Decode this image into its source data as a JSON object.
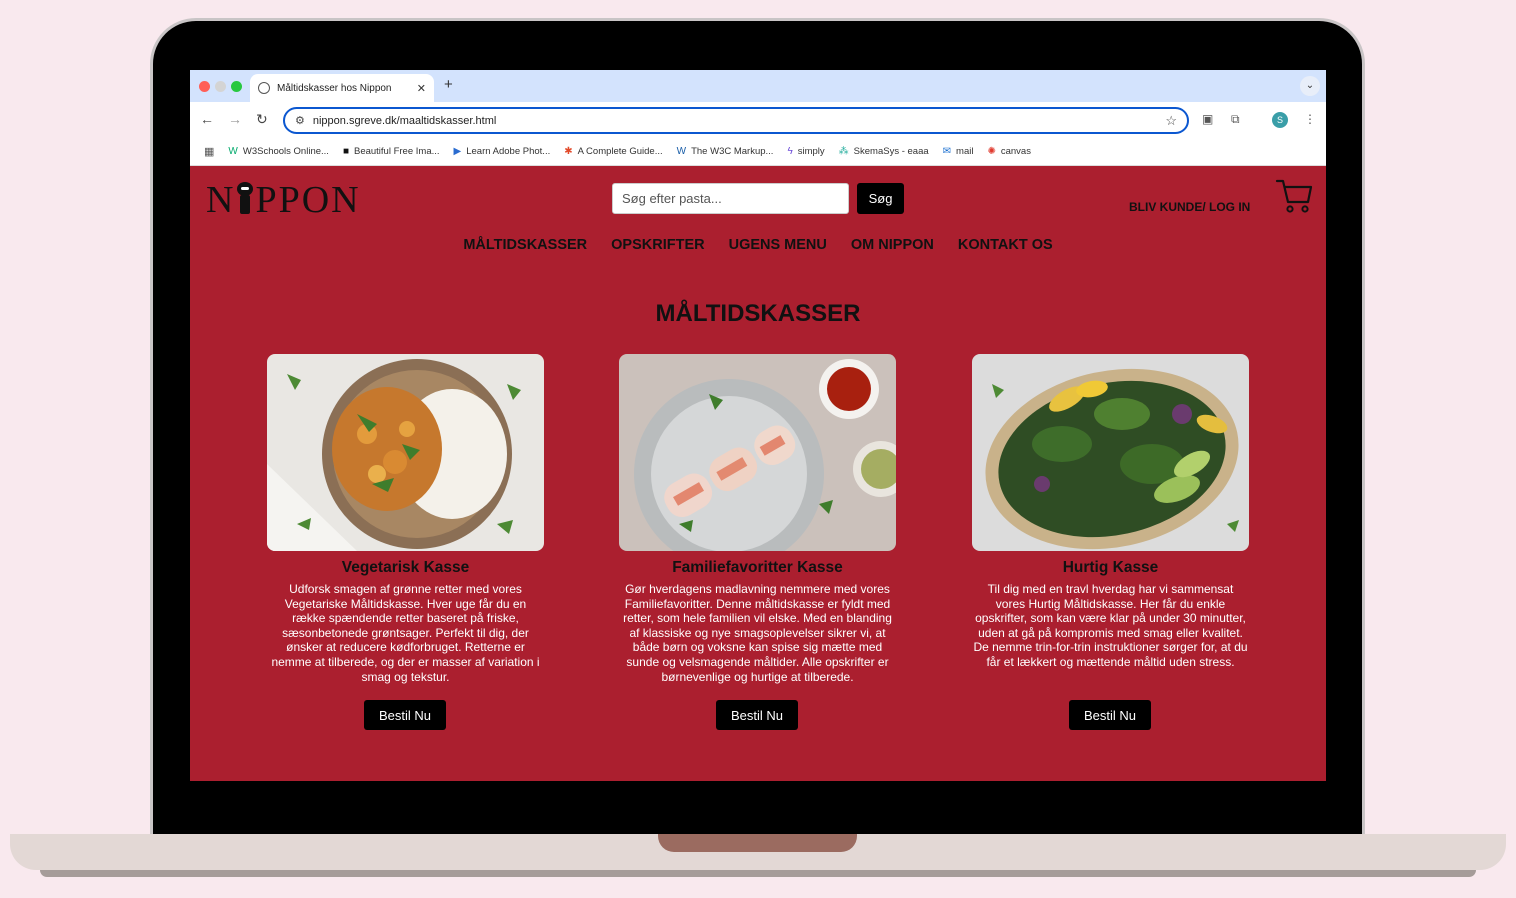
{
  "browser": {
    "tab_title": "Måltidskasser hos Nippon",
    "url": "nippon.sgreve.dk/maaltidskasser.html",
    "profile_initial": "S",
    "bookmarks": [
      {
        "label": "W3Schools Online...",
        "icon": "w3schools-icon"
      },
      {
        "label": "Beautiful Free Ima...",
        "icon": "unsplash-icon"
      },
      {
        "label": "Learn Adobe Phot...",
        "icon": "youtube-icon"
      },
      {
        "label": "A Complete Guide...",
        "icon": "css-tricks-icon"
      },
      {
        "label": "The W3C Markup...",
        "icon": "w3c-icon"
      },
      {
        "label": "simply",
        "icon": "simply-icon"
      },
      {
        "label": "SkemaSys - eaaa",
        "icon": "skemasys-icon"
      },
      {
        "label": "mail",
        "icon": "outlook-icon"
      },
      {
        "label": "canvas",
        "icon": "canvas-icon"
      }
    ]
  },
  "site": {
    "logo": {
      "before": "N",
      "after": "PPON"
    },
    "search": {
      "placeholder": "Søg efter pasta...",
      "button": "Søg"
    },
    "login_label": "BLIV KUNDE/ LOG IN",
    "nav": [
      "MÅLTIDSKASSER",
      "OPSKRIFTER",
      "UGENS MENU",
      "OM NIPPON",
      "KONTAKT OS"
    ],
    "page_title": "MÅLTIDSKASSER",
    "cards": [
      {
        "title": "Vegetarisk Kasse",
        "text": "Udforsk smagen af grønne retter med vores Vegetariske Måltidskasse. Hver uge får du en række spændende retter baseret på friske, sæsonbetonede grøntsager. Perfekt til dig, der ønsker at reducere kødforbruget. Retterne er nemme at tilberede, og der er masser af variation i smag og tekstur.",
        "button": "Bestil Nu"
      },
      {
        "title": "Familiefavoritter Kasse",
        "text": "Gør hverdagens madlavning nemmere med vores Familiefavoritter. Denne måltidskasse er fyldt med retter, som hele familien vil elske. Med en blanding af klassiske og nye smagsoplevelser sikrer vi, at både børn og voksne kan spise sig mætte med sunde og velsmagende måltider. Alle opskrifter er børnevenlige og hurtige at tilberede.",
        "button": "Bestil Nu"
      },
      {
        "title": "Hurtig Kasse",
        "text": "Til dig med en travl hverdag har vi sammensat vores Hurtig Måltidskasse. Her får du enkle opskrifter, som kan være klar på under 30 minutter, uden at gå på kompromis med smag eller kvalitet. De nemme trin-for-trin instruktioner sørger for, at du får et lækkert og mættende måltid uden stress.",
        "button": "Bestil Nu"
      }
    ]
  },
  "colors": {
    "site_bg": "#ab1f2f",
    "button_bg": "#000000",
    "omnibox_border": "#0b57d0"
  }
}
